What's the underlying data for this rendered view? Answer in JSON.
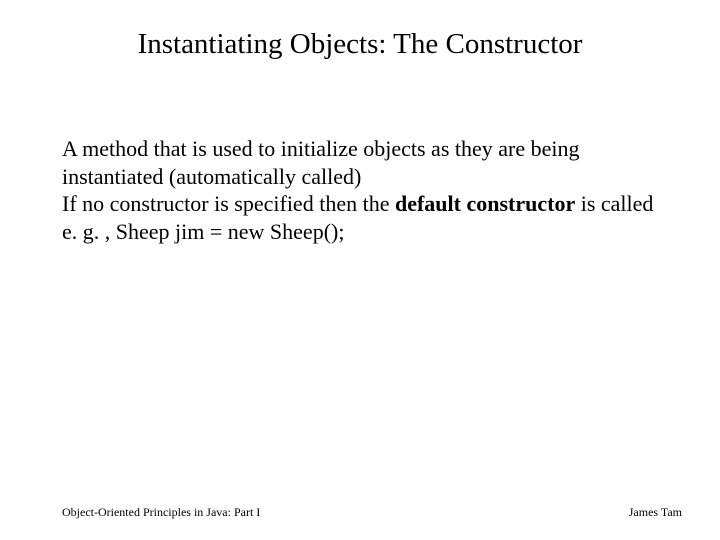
{
  "title": "Instantiating Objects: The Constructor",
  "body": {
    "p1": "A method that is used to initialize objects as they are being instantiated (automatically called)",
    "p2a": "If no constructor is specified then the ",
    "p2b": "default constructor",
    "p2c": " is called",
    "p3": "e. g. , Sheep jim = new Sheep();"
  },
  "footer": {
    "left": "Object-Oriented Principles in Java: Part I",
    "right": "James Tam"
  }
}
